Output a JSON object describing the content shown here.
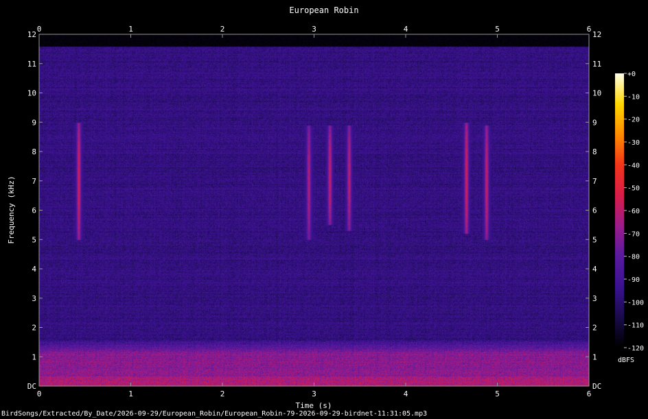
{
  "chart_data": {
    "type": "heatmap",
    "title": "European Robin",
    "xlabel": "Time (s)",
    "ylabel": "Frequency (kHz)",
    "xlim": [
      0,
      6
    ],
    "ylim": [
      0,
      12
    ],
    "x_ticks": [
      "0",
      "1",
      "2",
      "3",
      "4",
      "5",
      "6"
    ],
    "y_ticks": [
      "DC",
      "1",
      "2",
      "3",
      "4",
      "5",
      "6",
      "7",
      "8",
      "9",
      "10",
      "11",
      "12"
    ],
    "colorbar": {
      "unit": "dBFS",
      "range": [
        -120,
        0
      ],
      "ticks": [
        "+0",
        "-10",
        "-20",
        "-30",
        "-40",
        "-50",
        "-60",
        "-70",
        "-80",
        "-90",
        "-100",
        "-110",
        "-120"
      ]
    },
    "colormap": [
      "#000000",
      "#1a0b4b",
      "#3a1290",
      "#5a1a9e",
      "#9b1c8a",
      "#d81d4a",
      "#f2351a",
      "#ff8c00",
      "#ffd700",
      "#ffffe6"
    ],
    "data_cutoff_khz": 11.6,
    "noise_floor_dbfs": -96,
    "low_frequency_band": {
      "max_khz": 1.6,
      "level_dbfs": -70
    },
    "syllables": [
      {
        "t": 0.43,
        "f_min_khz": 5.0,
        "f_max_khz": 9.0,
        "peak_dbfs": -55
      },
      {
        "t": 2.94,
        "f_min_khz": 5.0,
        "f_max_khz": 8.9,
        "peak_dbfs": -62
      },
      {
        "t": 3.17,
        "f_min_khz": 5.5,
        "f_max_khz": 8.9,
        "peak_dbfs": -58
      },
      {
        "t": 3.38,
        "f_min_khz": 5.3,
        "f_max_khz": 8.9,
        "peak_dbfs": -60
      },
      {
        "t": 4.66,
        "f_min_khz": 5.2,
        "f_max_khz": 9.0,
        "peak_dbfs": -54
      },
      {
        "t": 4.88,
        "f_min_khz": 5.0,
        "f_max_khz": 8.9,
        "peak_dbfs": -57
      }
    ]
  },
  "file_path": "BirdSongs/Extracted/By_Date/2026-09-29/European_Robin/European_Robin-79-2026-09-29-birdnet-11:31:05.mp3"
}
